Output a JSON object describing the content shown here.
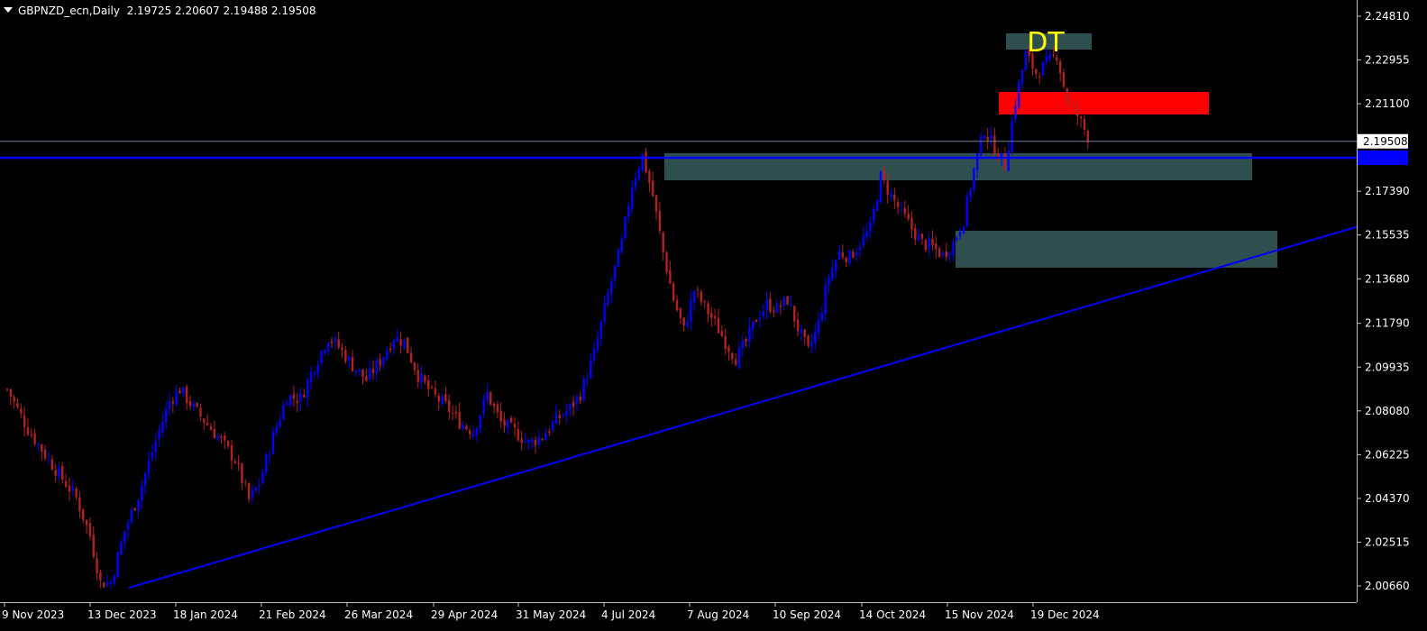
{
  "header": {
    "symbol": "GBPNZD_ecn,Daily",
    "ohlc": "2.19725 2.20607 2.19488 2.19508"
  },
  "annotation": {
    "text": "DT",
    "color": "#ffff00"
  },
  "chart_data": {
    "type": "candlestick",
    "y_ticks": [
      "2.24810",
      "2.22955",
      "2.21100",
      "2.17390",
      "2.15535",
      "2.13680",
      "2.11790",
      "2.09935",
      "2.08080",
      "2.06225",
      "2.04370",
      "2.02515",
      "2.00660"
    ],
    "x_ticks": [
      "9 Nov 2023",
      "13 Dec 2023",
      "18 Jan 2024",
      "21 Feb 2024",
      "26 Mar 2024",
      "29 Apr 2024",
      "31 May 2024",
      "4 Jul 2024",
      "7 Aug 2024",
      "10 Sep 2024",
      "14 Oct 2024",
      "15 Nov 2024",
      "19 Dec 2024"
    ],
    "ylim": [
      2.0052,
      2.25
    ],
    "current_price": {
      "label": "2.19508",
      "value": 2.19508
    },
    "horizontal_line": {
      "value": 2.1938,
      "color": "#0000ff"
    },
    "trendline": {
      "from": [
        "13 Dec 2023",
        2.0058
      ],
      "to": [
        "beyond 19 Dec 2024",
        2.1588
      ],
      "color": "#0000ff"
    },
    "zones": [
      {
        "name": "resistance-top-zone",
        "color": "#2f4f4f",
        "y": [
          2.2375,
          2.2414
        ],
        "x": [
          "18 Dec 2024",
          "31 Dec 2024"
        ]
      },
      {
        "name": "red-zone",
        "color": "#ff0000",
        "y": [
          2.206,
          2.217
        ],
        "x": [
          "10 Dec 2024",
          "12 Jan 2025"
        ]
      },
      {
        "name": "support-upper-zone",
        "color": "#2f4f4f",
        "y": [
          2.1776,
          2.1947
        ],
        "x": [
          "15 Jul 2024",
          "9 Jan 2025"
        ]
      },
      {
        "name": "support-lower-zone",
        "color": "#2f4f4f",
        "y": [
          2.1415,
          2.1568
        ],
        "x": [
          "15 Nov 2024",
          "12 Jan 2025"
        ]
      }
    ],
    "up_color": "#0000ff",
    "down_color": "#b22222",
    "close_path": [
      [
        0,
        2.09
      ],
      [
        6,
        2.073
      ],
      [
        13,
        2.058
      ],
      [
        20,
        2.044
      ],
      [
        24,
        2.028
      ],
      [
        27,
        2.008
      ],
      [
        30,
        2.008
      ],
      [
        34,
        2.03
      ],
      [
        38,
        2.045
      ],
      [
        43,
        2.068
      ],
      [
        47,
        2.085
      ],
      [
        50,
        2.09
      ],
      [
        54,
        2.082
      ],
      [
        58,
        2.075
      ],
      [
        62,
        2.068
      ],
      [
        66,
        2.06
      ],
      [
        70,
        2.043
      ],
      [
        73,
        2.05
      ],
      [
        77,
        2.07
      ],
      [
        81,
        2.087
      ],
      [
        85,
        2.086
      ],
      [
        89,
        2.1
      ],
      [
        93,
        2.112
      ],
      [
        96,
        2.108
      ],
      [
        100,
        2.1
      ],
      [
        104,
        2.094
      ],
      [
        108,
        2.102
      ],
      [
        112,
        2.112
      ],
      [
        115,
        2.11
      ],
      [
        119,
        2.096
      ],
      [
        123,
        2.088
      ],
      [
        127,
        2.083
      ],
      [
        131,
        2.076
      ],
      [
        135,
        2.072
      ],
      [
        139,
        2.088
      ],
      [
        143,
        2.076
      ],
      [
        147,
        2.072
      ],
      [
        151,
        2.067
      ],
      [
        155,
        2.07
      ],
      [
        159,
        2.077
      ],
      [
        163,
        2.082
      ],
      [
        166,
        2.088
      ],
      [
        170,
        2.105
      ],
      [
        174,
        2.13
      ],
      [
        178,
        2.152
      ],
      [
        181,
        2.177
      ],
      [
        184,
        2.189
      ],
      [
        187,
        2.172
      ],
      [
        190,
        2.148
      ],
      [
        193,
        2.128
      ],
      [
        196,
        2.115
      ],
      [
        199,
        2.132
      ],
      [
        202,
        2.125
      ],
      [
        205,
        2.118
      ],
      [
        208,
        2.11
      ],
      [
        211,
        2.103
      ],
      [
        214,
        2.11
      ],
      [
        217,
        2.12
      ],
      [
        220,
        2.126
      ],
      [
        223,
        2.124
      ],
      [
        226,
        2.128
      ],
      [
        229,
        2.116
      ],
      [
        232,
        2.106
      ],
      [
        235,
        2.118
      ],
      [
        238,
        2.138
      ],
      [
        241,
        2.148
      ],
      [
        244,
        2.146
      ],
      [
        247,
        2.152
      ],
      [
        250,
        2.158
      ],
      [
        253,
        2.18
      ],
      [
        256,
        2.172
      ],
      [
        259,
        2.165
      ],
      [
        262,
        2.158
      ],
      [
        265,
        2.152
      ],
      [
        268,
        2.15
      ],
      [
        271,
        2.147
      ],
      [
        274,
        2.152
      ],
      [
        277,
        2.162
      ],
      [
        280,
        2.183
      ],
      [
        283,
        2.2
      ],
      [
        286,
        2.192
      ],
      [
        289,
        2.185
      ],
      [
        292,
        2.212
      ],
      [
        295,
        2.232
      ],
      [
        298,
        2.224
      ],
      [
        301,
        2.228
      ],
      [
        304,
        2.232
      ],
      [
        307,
        2.212
      ],
      [
        310,
        2.206
      ],
      [
        313,
        2.197
      ]
    ]
  }
}
